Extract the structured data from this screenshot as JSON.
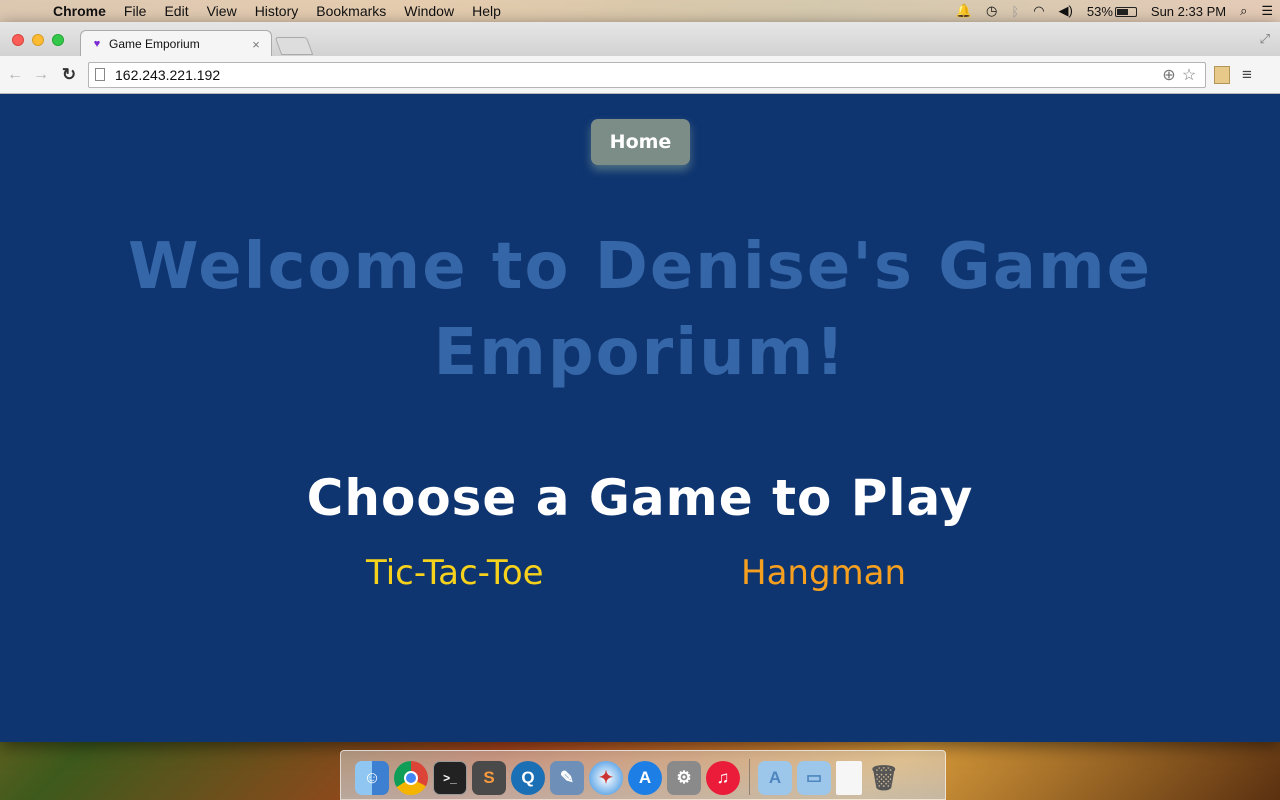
{
  "menubar": {
    "app_name": "Chrome",
    "items": [
      "File",
      "Edit",
      "View",
      "History",
      "Bookmarks",
      "Window",
      "Help"
    ],
    "battery_percent": "53%",
    "clock": "Sun 2:33 PM"
  },
  "browser": {
    "tab_title": "Game Emporium",
    "tab_close": "×",
    "url": "162.243.221.192"
  },
  "page": {
    "home_label": "Home",
    "welcome_heading": "Welcome to Denise's Game Emporium!",
    "choose_heading": "Choose a Game to Play",
    "games": [
      {
        "label": "Tic-Tac-Toe",
        "color": "#f6d21c"
      },
      {
        "label": "Hangman",
        "color": "#f7a020"
      }
    ]
  },
  "colors": {
    "page_background": "#0f3570",
    "welcome_text": "#3566a8",
    "home_button": "#7c8c87"
  },
  "dock": {
    "icons": [
      "finder-icon",
      "chrome-icon",
      "terminal-icon",
      "sublime-text-icon",
      "quicktime-icon",
      "preview-icon",
      "safari-icon",
      "app-store-icon",
      "system-preferences-icon",
      "itunes-icon",
      "applications-folder-icon",
      "documents-folder-icon",
      "file-icon",
      "trash-icon"
    ]
  }
}
